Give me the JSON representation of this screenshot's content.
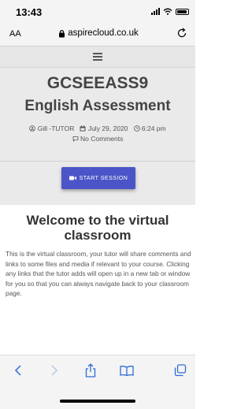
{
  "status_bar": {
    "time": "13:43",
    "icons": [
      "signal-icon",
      "wifi-icon",
      "battery-icon"
    ]
  },
  "browser": {
    "text_size_label": "AA",
    "url": "aspirecloud.co.uk",
    "reload_icon": "reload-icon"
  },
  "site": {
    "title": "GCSEEASS9",
    "menu_icon": "hamburger-icon"
  },
  "post": {
    "title": "English Assessment",
    "author": "Gill -TUTOR",
    "date": "July 29, 2020",
    "time": "6:24 pm",
    "comments": "No Comments"
  },
  "cta": {
    "label": "START SESSION",
    "icon": "video-camera-icon"
  },
  "content": {
    "heading": "Welcome to the virtual classroom",
    "paragraph": "This is the virtual classroom, your tutor will share comments and links to some files and media if relevant to your course. Clicking any links that the tutor adds will open up in a new tab or window for you so that you can always navigate back to your classroom page."
  },
  "toolbar": {
    "icons": [
      "back-icon",
      "forward-icon",
      "share-icon",
      "bookmarks-icon",
      "tabs-icon"
    ]
  },
  "colors": {
    "accent": "#4b55c7",
    "hero_bg": "#eaeaea",
    "chrome_bg": "#f4f4f4"
  }
}
